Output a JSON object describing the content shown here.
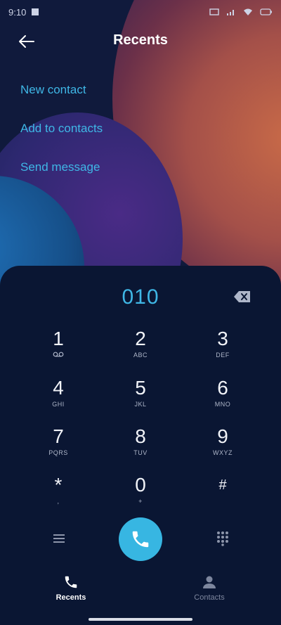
{
  "status_bar": {
    "time": "9:10"
  },
  "header": {
    "title": "Recents"
  },
  "actions": [
    {
      "label": "New contact"
    },
    {
      "label": "Add to contacts"
    },
    {
      "label": "Send message"
    }
  ],
  "dialer": {
    "number": "010",
    "keys": [
      {
        "digit": "1",
        "sub": "voicemail-icon"
      },
      {
        "digit": "2",
        "sub": "ABC"
      },
      {
        "digit": "3",
        "sub": "DEF"
      },
      {
        "digit": "4",
        "sub": "GHI"
      },
      {
        "digit": "5",
        "sub": "JKL"
      },
      {
        "digit": "6",
        "sub": "MNO"
      },
      {
        "digit": "7",
        "sub": "PQRS"
      },
      {
        "digit": "8",
        "sub": "TUV"
      },
      {
        "digit": "9",
        "sub": "WXYZ"
      },
      {
        "digit": "*",
        "sub": ","
      },
      {
        "digit": "0",
        "sub": "+"
      },
      {
        "digit": "#",
        "sub": ""
      }
    ]
  },
  "nav": {
    "recents_label": "Recents",
    "contacts_label": "Contacts"
  },
  "colors": {
    "accent": "#3fb7e6",
    "call_button": "#37b6e2",
    "panel_background": "#0a1633"
  }
}
